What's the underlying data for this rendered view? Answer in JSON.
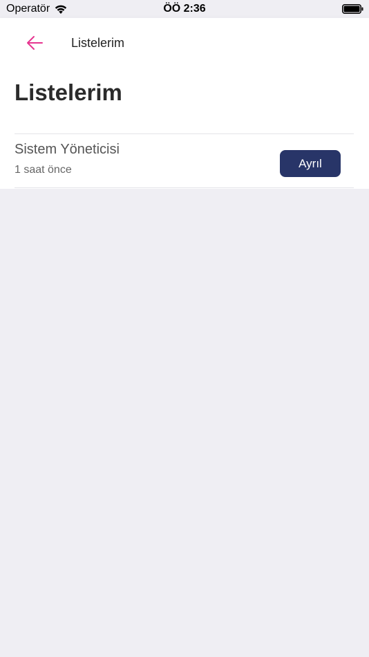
{
  "status_bar": {
    "carrier": "Operatör",
    "time": "ÖÖ 2:36"
  },
  "nav": {
    "title": "Listelerim"
  },
  "page": {
    "title": "Listelerim"
  },
  "lists": [
    {
      "name": "Sistem Yöneticisi",
      "time": "1 saat önce",
      "action_label": "Ayrıl"
    }
  ],
  "colors": {
    "accent": "#e6348f",
    "button": "#283568",
    "background": "#efeef3"
  },
  "icons": {
    "back": "arrow-left-icon",
    "wifi": "wifi-icon",
    "battery": "battery-icon"
  }
}
